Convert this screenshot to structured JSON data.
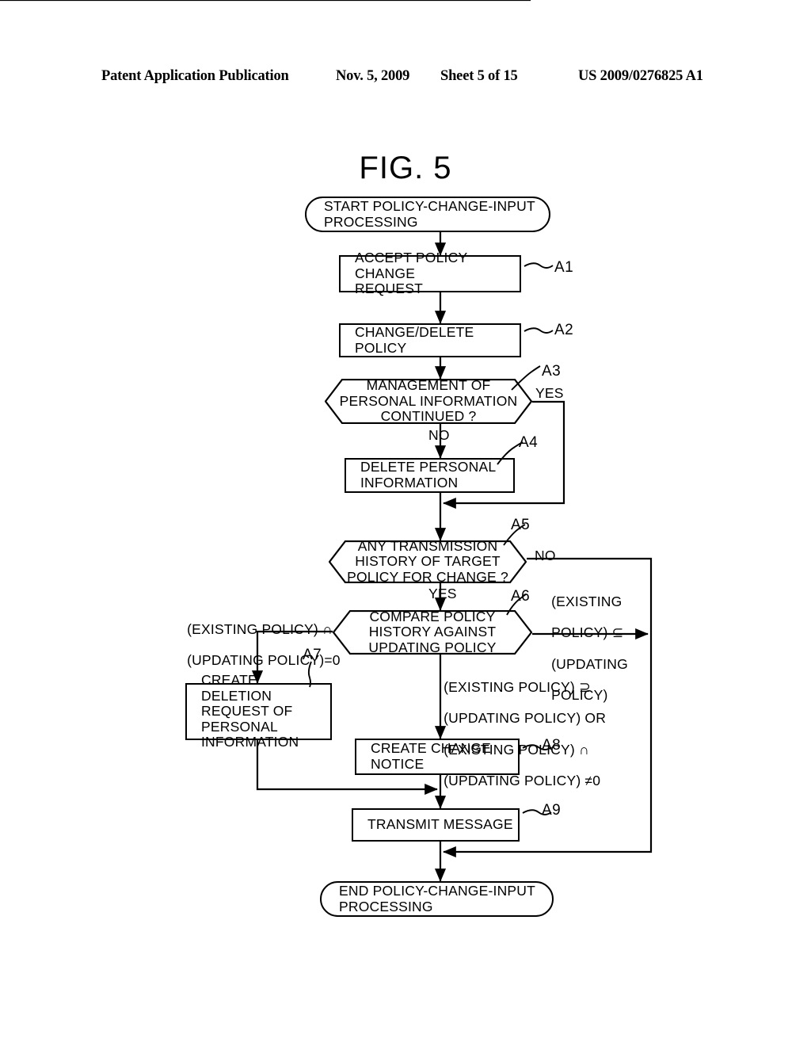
{
  "header": {
    "publication": "Patent Application Publication",
    "date": "Nov. 5, 2009",
    "sheet": "Sheet 5 of 15",
    "patent_number": "US 2009/0276825 A1"
  },
  "figure": {
    "title": "FIG. 5",
    "nodes": {
      "start": {
        "id": "",
        "line1": "START POLICY-CHANGE-INPUT",
        "line2": "PROCESSING"
      },
      "a1": {
        "id": "A1",
        "line1": "ACCEPT POLICY CHANGE",
        "line2": "REQUEST"
      },
      "a2": {
        "id": "A2",
        "line1": "CHANGE/DELETE POLICY",
        "line2": ""
      },
      "a3": {
        "id": "A3",
        "line1": "MANAGEMENT OF",
        "line2": "PERSONAL INFORMATION",
        "line3": "CONTINUED ?"
      },
      "a4": {
        "id": "A4",
        "line1": "DELETE PERSONAL",
        "line2": "INFORMATION"
      },
      "a5": {
        "id": "A5",
        "line1": "ANY TRANSMISSION",
        "line2": "HISTORY OF TARGET",
        "line3": "POLICY FOR CHANGE ?"
      },
      "a6": {
        "id": "A6",
        "line1": "COMPARE POLICY",
        "line2": "HISTORY AGAINST",
        "line3": "UPDATING POLICY"
      },
      "a7": {
        "id": "A7",
        "line1": "CREATE DELETION",
        "line2": "REQUEST OF",
        "line3": "PERSONAL",
        "line4": "INFORMATION"
      },
      "a8": {
        "id": "A8",
        "line1": "CREATE CHANGE",
        "line2": "NOTICE"
      },
      "a9": {
        "id": "A9",
        "line1": "TRANSMIT MESSAGE",
        "line2": ""
      },
      "end": {
        "id": "",
        "line1": "END POLICY-CHANGE-INPUT",
        "line2": "PROCESSING"
      }
    },
    "branch_labels": {
      "a3_yes": "YES",
      "a3_no": "NO",
      "a5_yes": "YES",
      "a5_no": "NO",
      "a6_left_l1": "(EXISTING POLICY) ∩",
      "a6_left_l2": "(UPDATING POLICY)=0",
      "a6_right_l1": "(EXISTING",
      "a6_right_l2": "POLICY) ⊆",
      "a6_right_l3": "(UPDATING",
      "a6_right_l4": "POLICY)",
      "a6_down_l1": "(EXISTING POLICY) ⊇",
      "a6_down_l2": "(UPDATING POLICY) OR",
      "a6_down_l3": "(EXISTING POLICY) ∩",
      "a6_down_l4": "(UPDATING POLICY) ≠0"
    }
  },
  "colors": {
    "ink": "#000000",
    "paper": "#ffffff"
  }
}
